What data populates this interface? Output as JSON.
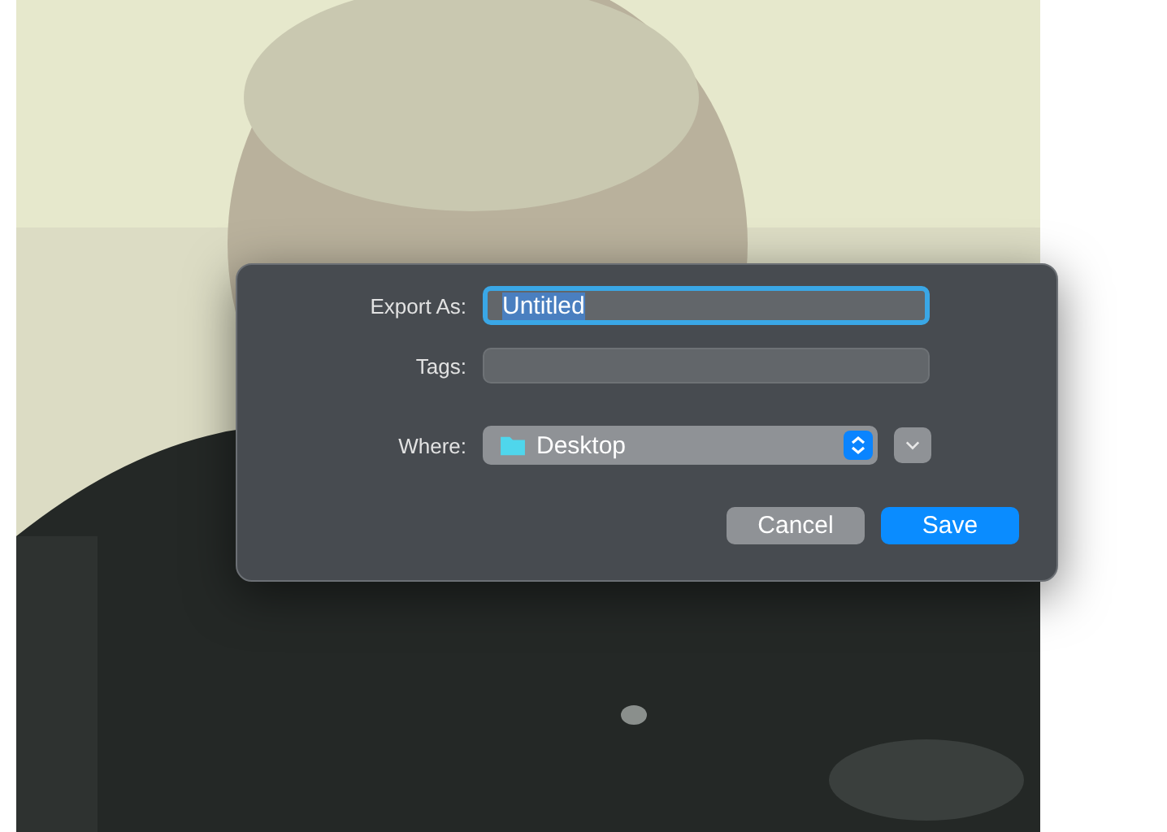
{
  "dialog": {
    "name_field": {
      "label": "Export As:",
      "value": "Untitled",
      "focused": true
    },
    "tags_field": {
      "label": "Tags:"
    },
    "where": {
      "label": "Where:",
      "value": "Desktop"
    },
    "buttons": [
      {
        "label": "Cancel",
        "kind": "secondary"
      },
      {
        "label": "Save",
        "kind": "primary"
      }
    ]
  }
}
